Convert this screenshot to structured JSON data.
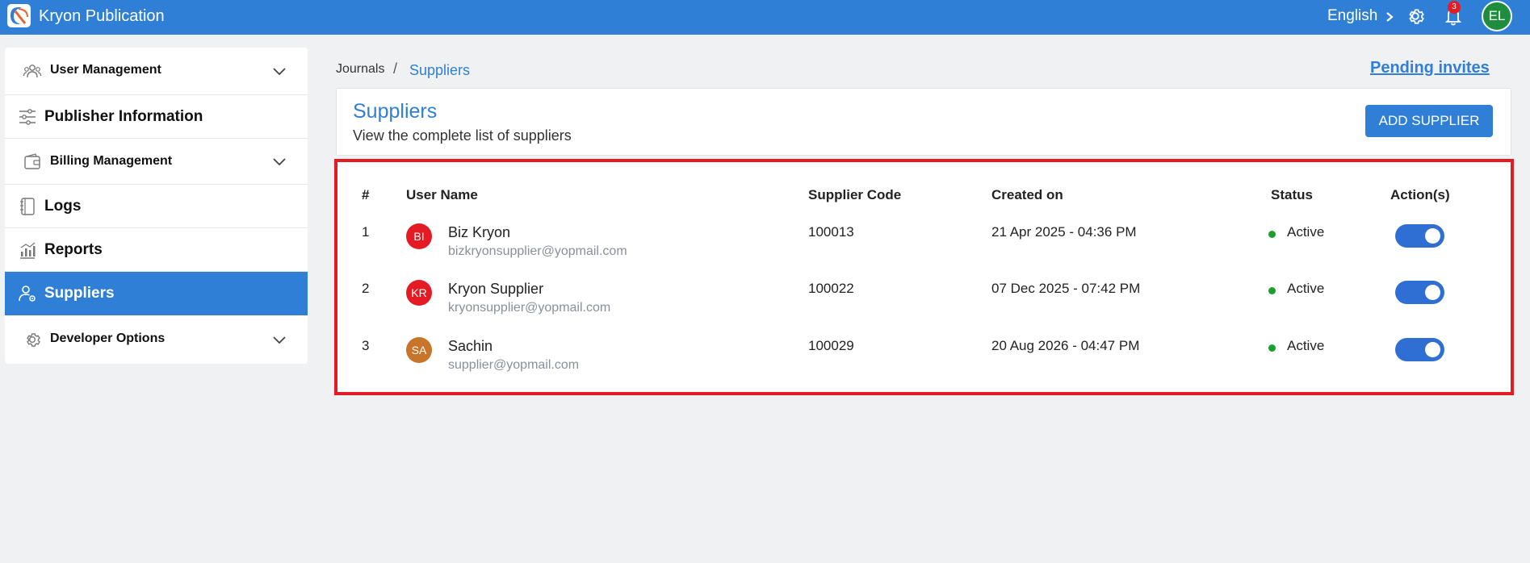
{
  "app": {
    "title": "Kryon Publication"
  },
  "topbar": {
    "language": "English",
    "notification_count": "3",
    "user_initials": "EL"
  },
  "sidebar": {
    "items": [
      {
        "label": "User Management",
        "icon": "users-icon",
        "expandable": true
      },
      {
        "label": "Publisher Information",
        "icon": "sliders-icon",
        "expandable": false
      },
      {
        "label": "Billing Management",
        "icon": "wallet-icon",
        "expandable": true
      },
      {
        "label": "Logs",
        "icon": "notebook-icon",
        "expandable": false
      },
      {
        "label": "Reports",
        "icon": "bar-chart-icon",
        "expandable": false
      },
      {
        "label": "Suppliers",
        "icon": "user-settings-icon",
        "expandable": false,
        "active": true
      },
      {
        "label": "Developer Options",
        "icon": "gear-icon",
        "expandable": true
      }
    ]
  },
  "breadcrumb": {
    "parent": "Journals",
    "separator": "/",
    "current": "Suppliers"
  },
  "pending_invites_label": "Pending invites",
  "header": {
    "title": "Suppliers",
    "subtitle": "View the complete list of suppliers",
    "add_button_label": "ADD SUPPLIER"
  },
  "table": {
    "columns": [
      "#",
      "User Name",
      "Supplier Code",
      "Created on",
      "Status",
      "Action(s)"
    ],
    "rows": [
      {
        "index": "1",
        "initials": "BI",
        "avatar_color": "#e41b23",
        "name": "Biz Kryon",
        "email": "bizkryonsupplier@yopmail.com",
        "code": "100013",
        "created": "21 Apr 2025 - 04:36 PM",
        "status": "Active",
        "enabled": true
      },
      {
        "index": "2",
        "initials": "KR",
        "avatar_color": "#e41b23",
        "name": "Kryon Supplier",
        "email": "kryonsupplier@yopmail.com",
        "code": "100022",
        "created": "07 Dec 2025 - 07:42 PM",
        "status": "Active",
        "enabled": true
      },
      {
        "index": "3",
        "initials": "SA",
        "avatar_color": "#c8742a",
        "name": "Sachin",
        "email": "supplier@yopmail.com",
        "code": "100029",
        "created": "20 Aug 2026 - 04:47 PM",
        "status": "Active",
        "enabled": true
      }
    ]
  },
  "colors": {
    "primary": "#2f7fd6",
    "status_active": "#1a9e2c",
    "highlight_border": "#e41b23"
  }
}
